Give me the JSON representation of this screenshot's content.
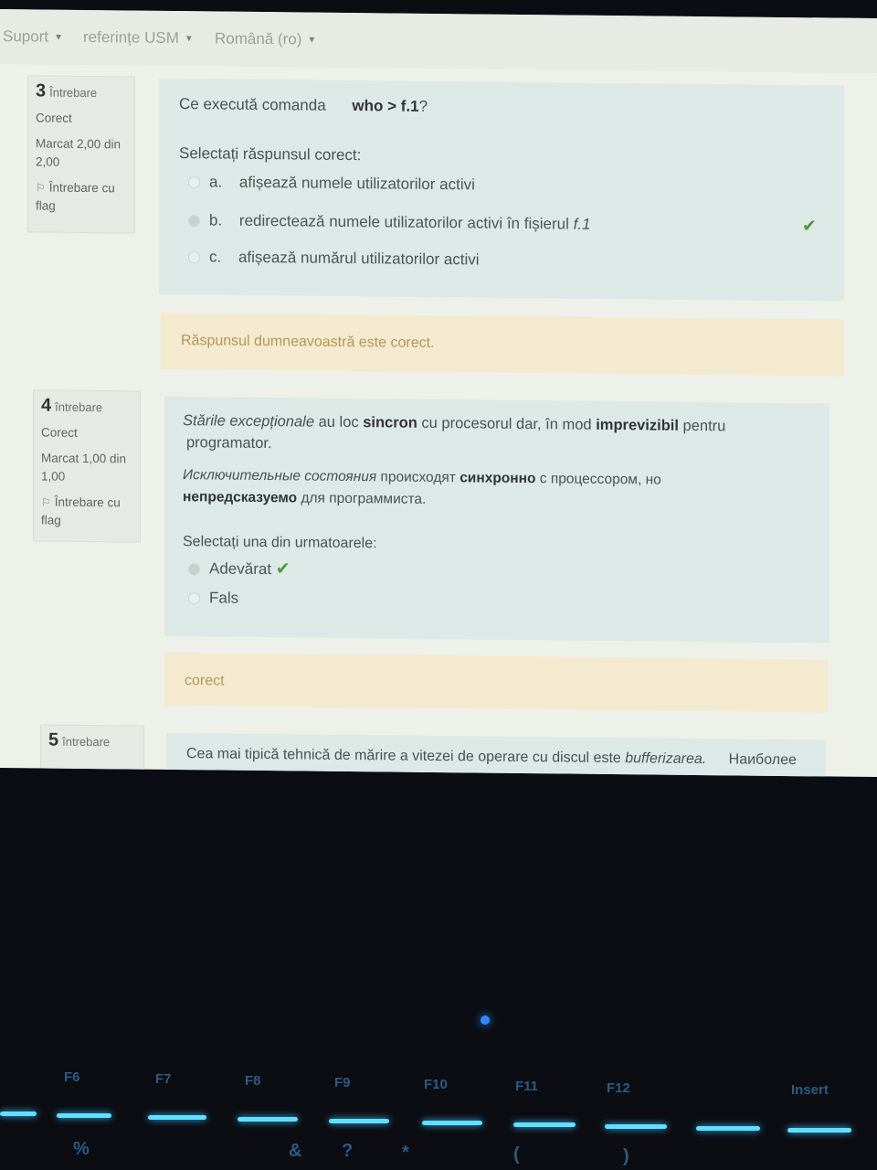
{
  "navbar": {
    "items": [
      {
        "label": "Suport"
      },
      {
        "label": "referințe USM"
      },
      {
        "label": "Română (ro)"
      }
    ]
  },
  "questions": [
    {
      "number": "3",
      "word": "Întrebare",
      "status": "Corect",
      "mark": "Marcat 2,00 din 2,00",
      "flag_label": "Întrebare cu flag",
      "text_prefix": "Ce execută comanda",
      "text_code": "who > f.1",
      "text_suffix": "?",
      "prompt": "Selectați răspunsul corect:",
      "options": [
        {
          "letter": "a.",
          "text": "afișează numele utilizatorilor activi"
        },
        {
          "letter": "b.",
          "text": "redirectează numele utilizatorilor activi în fișierul ",
          "italic": "f.1"
        },
        {
          "letter": "c.",
          "text": "afișează numărul utilizatorilor activi"
        }
      ],
      "feedback": "Răspunsul dumneavoastră este corect."
    },
    {
      "number": "4",
      "word": "întrebare",
      "status": "Corect",
      "mark": "Marcat 1,00 din 1,00",
      "flag_label": "Întrebare cu flag",
      "ro": {
        "p1_italic": "Stările excepționale",
        "p2": " au loc ",
        "p3_bold": "sincron",
        "p4": " cu procesorul dar, în mod ",
        "p5_bold": "imprevizibil",
        "p6": " pentru",
        "p7": "programator."
      },
      "ru": {
        "p1_italic": "Исключительные состояния",
        "p2": " происходят ",
        "p3_bold": "синхронно",
        "p4": " с процессором, но",
        "p5_bold": "непредсказуемо",
        "p6": " для программиста."
      },
      "prompt": "Selectați una din urmatoarele:",
      "options": [
        {
          "text": "Adevărat"
        },
        {
          "text": "Fals"
        }
      ],
      "feedback": "corect"
    },
    {
      "number": "5",
      "word": "întrebare",
      "text_prefix": "Cea mai tipică tehnică de mărire a vitezei de operare cu discul este ",
      "text_italic": "bufferizarea.",
      "text_ru": "Наиболее"
    }
  ],
  "keyboard": {
    "fkeys": [
      "F6",
      "F7",
      "F8",
      "F9",
      "F10",
      "F11",
      "F12",
      "Insert"
    ],
    "symbols": [
      "%",
      "&",
      "?",
      "*",
      "(",
      ")"
    ]
  },
  "colors": {
    "screen_bg": "#eef0ea",
    "question_bg": "#dce9e6",
    "feedback_bg": "#f4ead0",
    "check": "#4e9a3a",
    "keyboard_glow": "#5fe0ff"
  }
}
